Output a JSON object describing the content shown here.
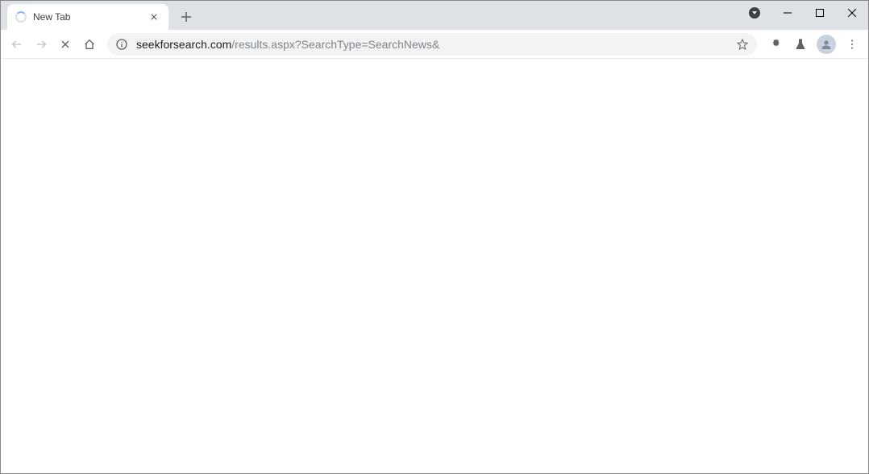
{
  "tab": {
    "title": "New Tab"
  },
  "url": {
    "domain": "seekforsearch.com",
    "path": "/results.aspx?SearchType=SearchNews&"
  }
}
